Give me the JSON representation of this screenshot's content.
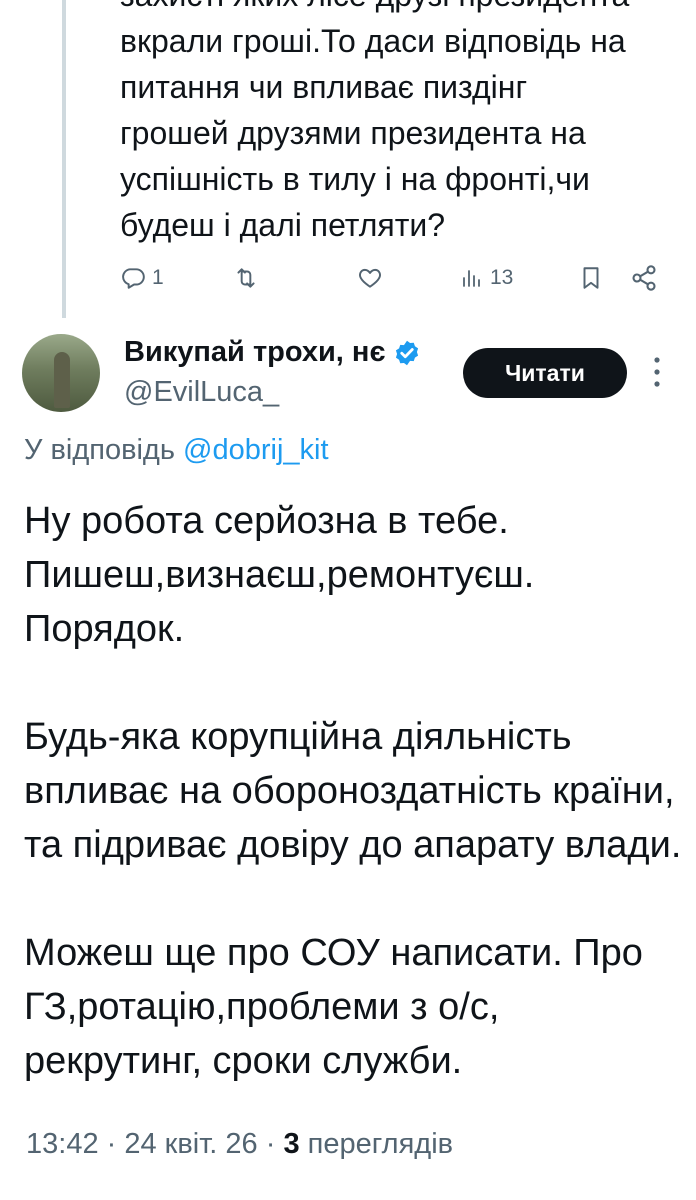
{
  "previous_reply": {
    "text_lines": [
      "захисті яких лісе друзі президента",
      "вкрали гроші.То даси відповідь на",
      "питання чи впливає пиздінг",
      "грошей друзями президента на",
      "успішність в тилу і на фронті,чи",
      "будеш і далі петляти?"
    ],
    "actions": {
      "reply_count": "1",
      "views_count": "13"
    }
  },
  "tweet": {
    "display_name": "Викупай трохи, нє",
    "handle": "@EvilLuca_",
    "follow_label": "Читати",
    "reply_prefix": "У відповідь ",
    "reply_to": "@dobrij_kit",
    "paragraphs": [
      "Ну робота серйозна в тебе. Пишеш,визнаєш,ремонтуєш. Порядок.",
      "Будь-яка корупційна діяльність впливає на обороноздатність країни, та підриває довіру до апарату влади.",
      "Можеш ще про СОУ написати. Про ГЗ,ротацію,проблеми з о/с, рекрутинг, сроки служби."
    ],
    "time": "13:42",
    "date": "24 квіт. 26",
    "views_number": "3",
    "views_label": "переглядів"
  },
  "icons": {
    "reply": "comment-icon",
    "retweet": "retweet-icon",
    "like": "heart-icon",
    "views": "views-icon",
    "bookmark": "bookmark-icon",
    "share": "share-icon",
    "verified": "verified-badge-icon",
    "more": "more-vertical-icon"
  },
  "colors": {
    "verified": "#1d9bf0",
    "link": "#1d9bf0",
    "muted": "#536471",
    "button_bg": "#0f1419"
  }
}
